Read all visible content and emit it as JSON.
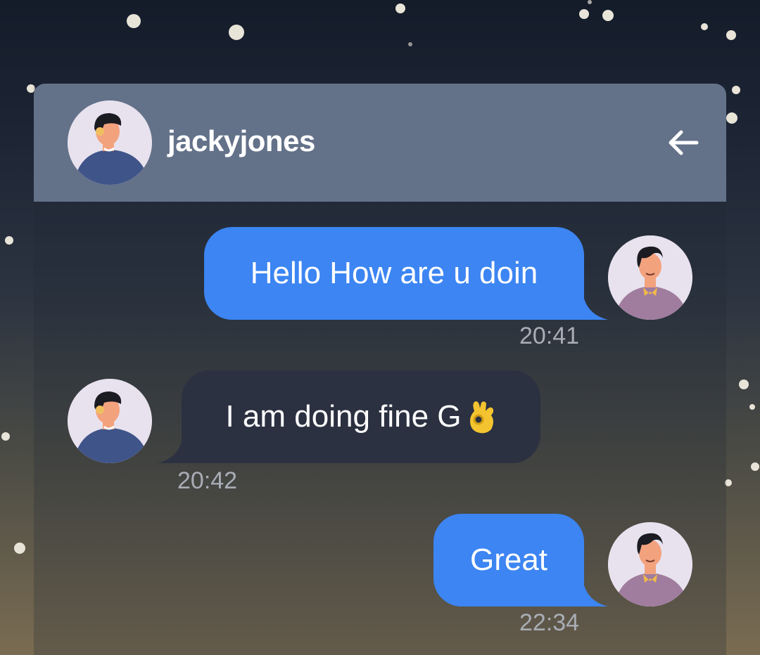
{
  "header": {
    "username": "jackyjones",
    "back_icon": "arrow-left-icon"
  },
  "messages": [
    {
      "direction": "outgoing",
      "text": "Hello How are u doin",
      "time": "20:41"
    },
    {
      "direction": "incoming",
      "text": "I am doing fine G",
      "emoji": "ok-hand-icon",
      "time": "20:42"
    },
    {
      "direction": "outgoing",
      "text": "Great",
      "time": "22:34"
    }
  ],
  "colors": {
    "header": "#637189",
    "outgoing_bubble": "#3c85f2",
    "incoming_bubble": "#2b3140",
    "timestamp": "#a9adb5"
  }
}
